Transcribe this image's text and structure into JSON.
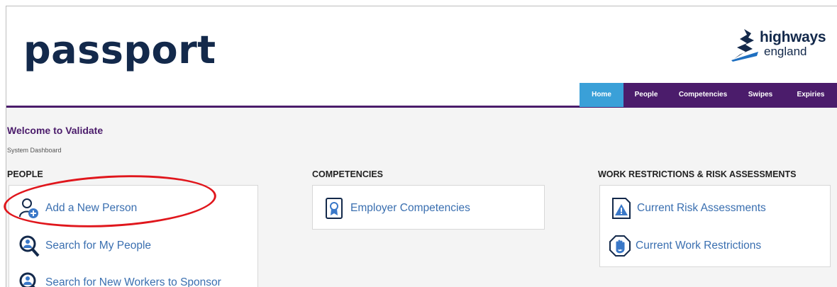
{
  "header": {
    "app_title": "passport",
    "brand": {
      "line1": "highways",
      "line2": "england"
    }
  },
  "nav": {
    "tabs": [
      {
        "label": "Home",
        "active": true
      },
      {
        "label": "People",
        "active": false
      },
      {
        "label": "Competencies",
        "active": false
      },
      {
        "label": "Swipes",
        "active": false
      },
      {
        "label": "Expiries",
        "active": false
      }
    ]
  },
  "page": {
    "welcome": "Welcome to Validate",
    "subtitle": "System Dashboard"
  },
  "sections": {
    "people": {
      "title": "PEOPLE",
      "items": [
        {
          "label": "Add a New Person",
          "icon": "add-person-icon"
        },
        {
          "label": "Search for My People",
          "icon": "search-person-icon"
        },
        {
          "label": "Search for New Workers to Sponsor",
          "icon": "search-worker-icon"
        }
      ]
    },
    "competencies": {
      "title": "COMPETENCIES",
      "items": [
        {
          "label": "Employer Competencies",
          "icon": "certificate-icon"
        }
      ]
    },
    "work_restrictions": {
      "title": "WORK RESTRICTIONS & RISK ASSESSMENTS",
      "items": [
        {
          "label": "Current Risk Assessments",
          "icon": "warning-document-icon"
        },
        {
          "label": "Current Work Restrictions",
          "icon": "stop-hand-icon"
        }
      ]
    }
  },
  "colors": {
    "navy": "#13294b",
    "purple": "#4b1c6b",
    "active_tab": "#3aa0d8",
    "link": "#3a6fb0",
    "highlight": "#e0161c"
  }
}
